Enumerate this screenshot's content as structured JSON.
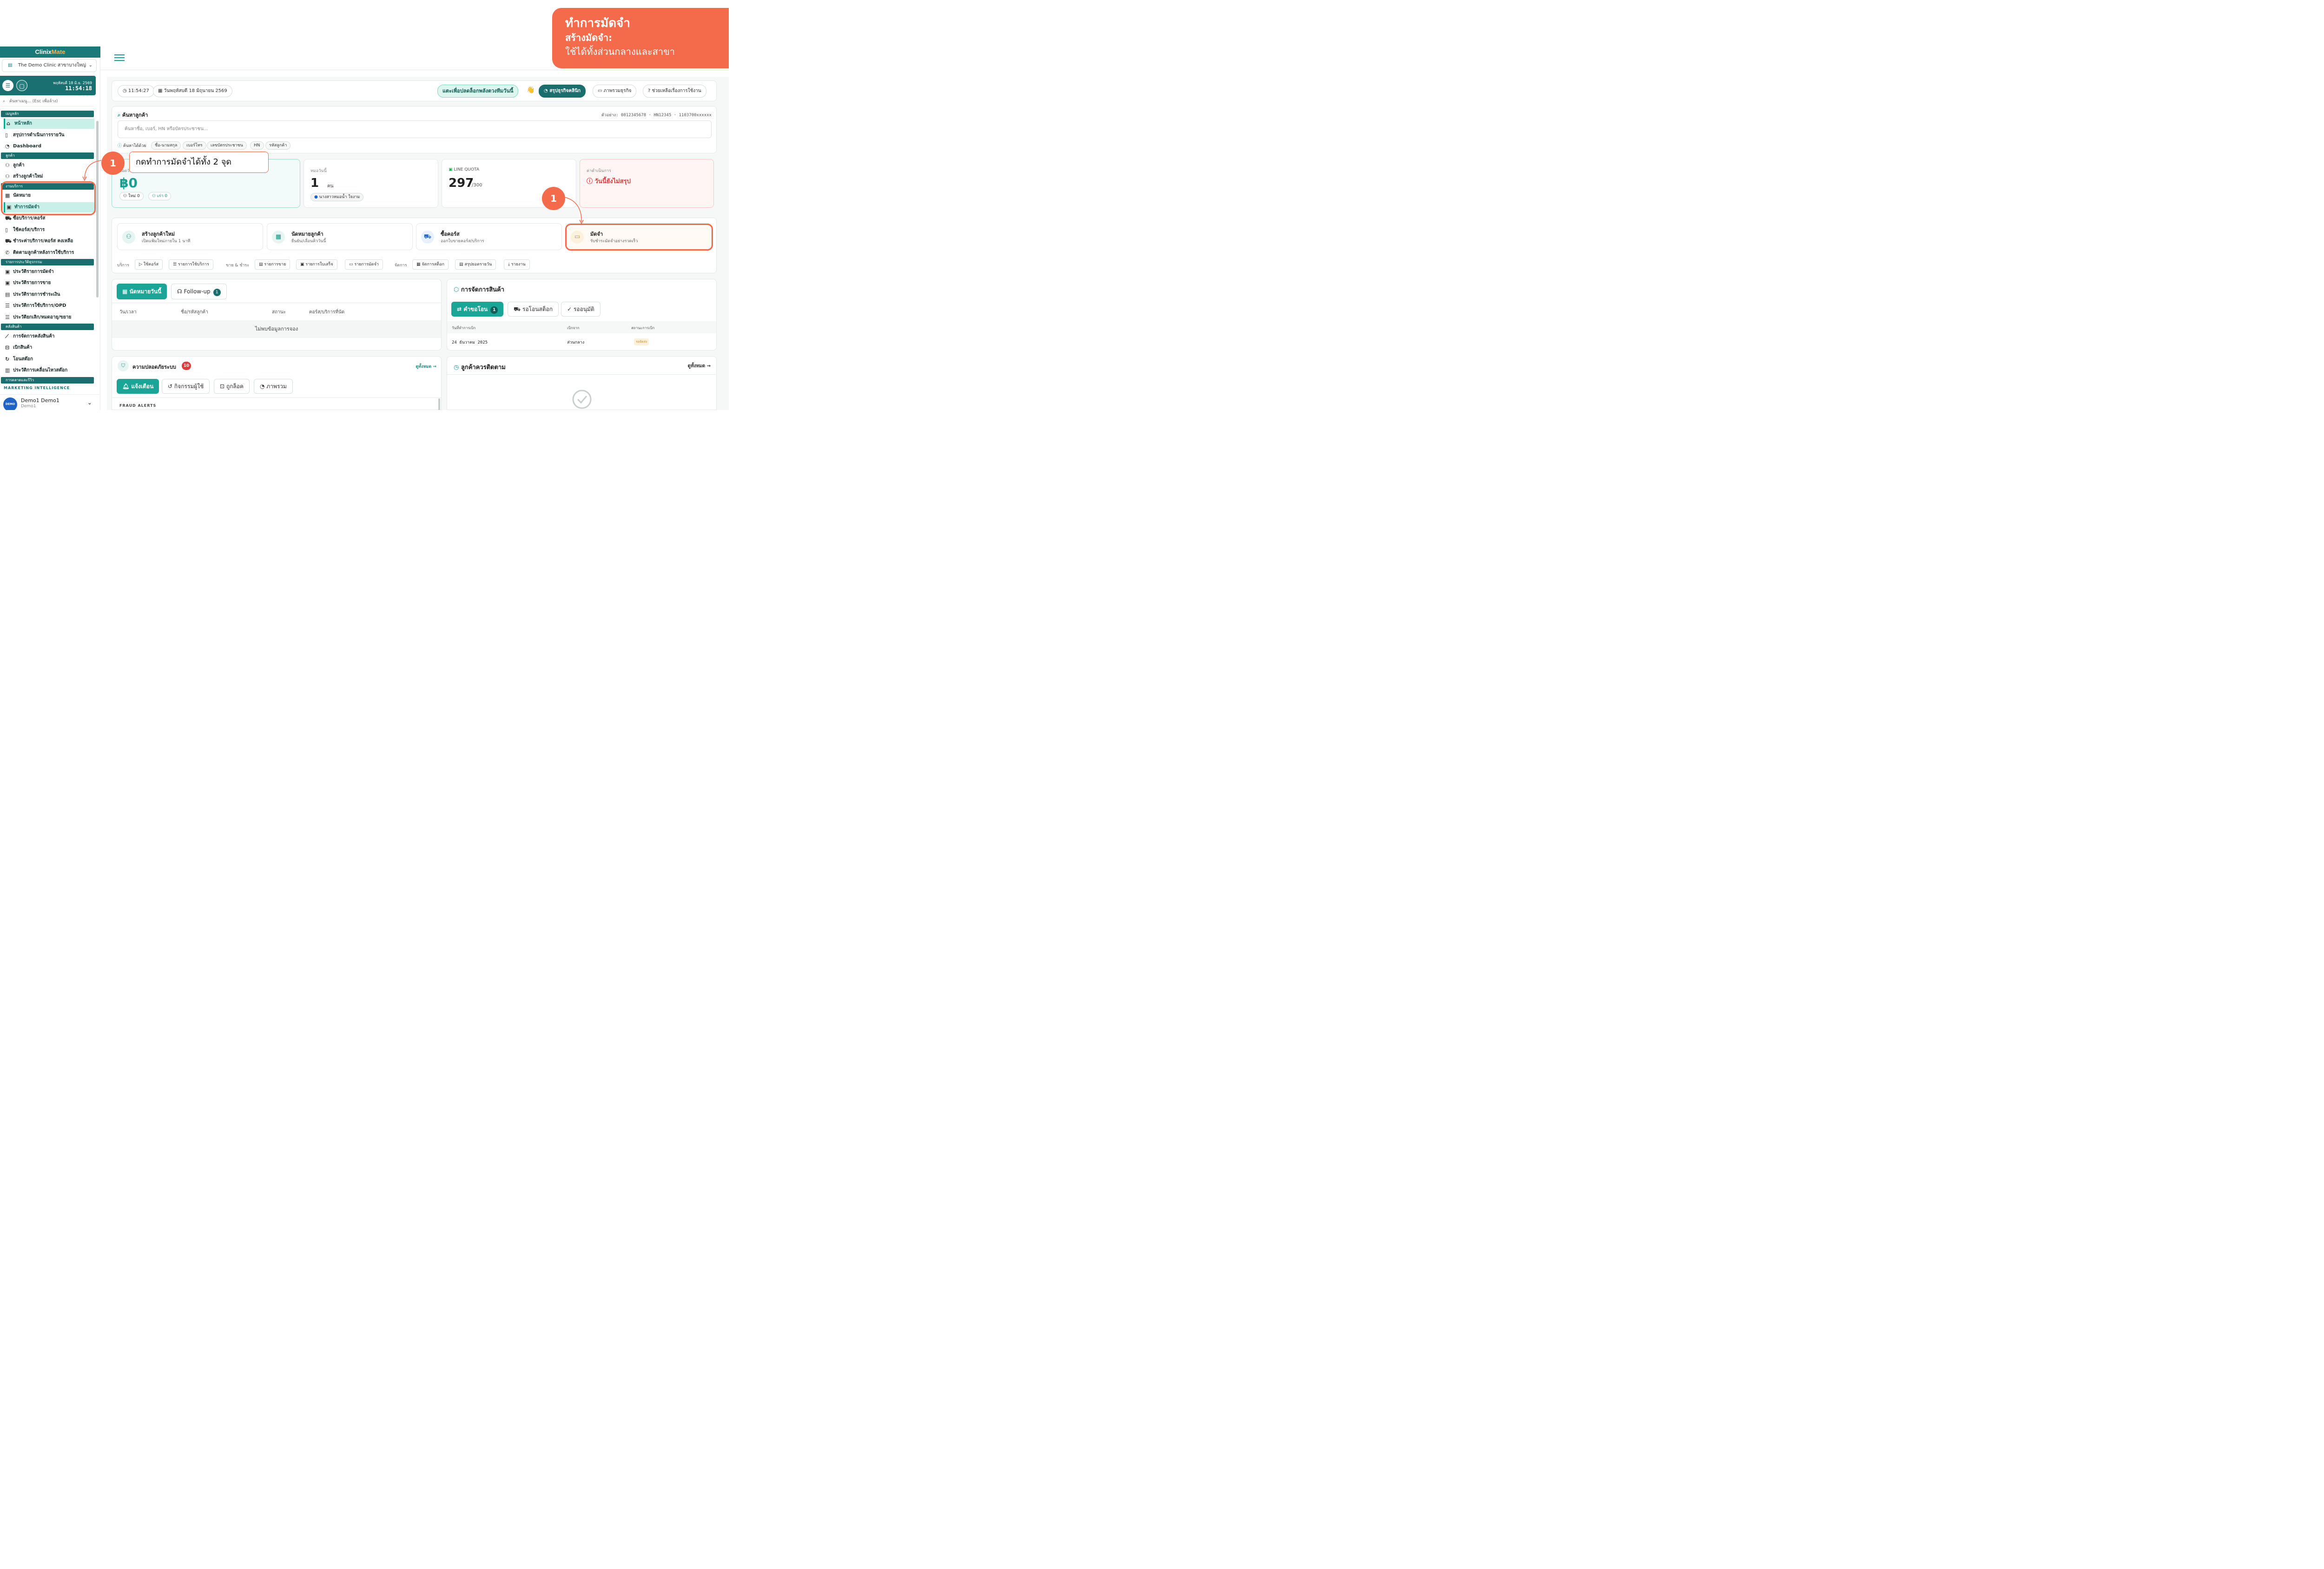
{
  "banner": {
    "title": "ทำการมัดจำ",
    "subtitle": "สร้างมัดจำ:",
    "desc": "ใช้ได้ทั้งส่วนกลางและสาขา"
  },
  "sidebar": {
    "brand_a": "Clinix",
    "brand_b": "Mate",
    "clinic": "The Demo Clinic สาขาบางใหญ่",
    "clock_date": "พฤหัสบดี 18 มิ.ย. 2569",
    "clock_time": "11:54:18",
    "search_placeholder": "ค้นหาเมนู... (Esc เพื่อล้าง)",
    "sections": {
      "main": "เมนูหลัก",
      "customer": "ลูกค้า",
      "service": "งานบริการ",
      "history": "รายการประวัติธุรกรรม",
      "stock": "คลังสินค้า",
      "marketing": "การตลาดและรีวิว"
    },
    "items": {
      "home": "หน้าหลัก",
      "daily": "สรุปการดำเนินการรายวัน",
      "dashboard": "Dashboard",
      "customers": "ลูกค้า",
      "new_customer": "สร้างลูกค้าใหม่",
      "appointments": "นัดหมาย",
      "deposit": "ทำการมัดจำ",
      "buy": "ซื้อบริการ/คอร์ส",
      "use": "ใช้คอร์ส/บริการ",
      "pay_remain": "ชำระค่าบริการ/คอร์ส คงเหลือ",
      "followup": "ติดตามลูกค้าหลังการใช้บริการ",
      "h_deposit": "ประวัติรายการมัดจำ",
      "h_sales": "ประวัติรายการขาย",
      "h_pay": "ประวัติรายการชำระเงิน",
      "h_opd": "ประวัติการใช้บริการ/OPD",
      "h_cancel": "ประวัติยกเลิก/หมดอายุ/ขยาย",
      "stock_manage": "การจัดการคลังสินค้า",
      "withdraw": "เบิกสินค้า",
      "transfer": "โอนสต๊อก",
      "movement": "ประวัติการเคลื่อนไหวสต๊อก"
    },
    "marketing_intel": "MARKETING INTELLIGENCE",
    "user_name": "Demo1 Demo1",
    "user_sub": "Demo1",
    "avatar": "DEMO"
  },
  "topbar": {
    "time": "11:54:27",
    "date": "วันพฤหัสบดี 18 มิถุนายน 2569",
    "unlock": "แตะเพื่อปลดล็อกพลังตวงทีมวันนี้",
    "summary": "สรุปธุรกิจคลินิก",
    "overview": "ภาพรวมธุรกิจ",
    "help": "ช่วยเหลือเรื่องการใช้งาน"
  },
  "search": {
    "title": "ค้นหาลูกค้า",
    "example": "ตัวอย่าง: 0812345678 · HN12345 · 1103700xxxxxx",
    "placeholder": "ค้นหาชื่อ, เบอร์, HN หรือบัตรประชาชน...",
    "by": "ค้นหาได้ด้วย",
    "tags": [
      "ชื่อ-นามสกุล",
      "เบอร์โทร",
      "เลขบัตรประชาชน",
      "HN",
      "รหัสลูกค้า"
    ]
  },
  "stats": {
    "sales_label": "ยอดวันนี้",
    "sales_value": "฿0",
    "new": "ใหม่ 0",
    "old": "เก่า 0",
    "doctor_label": "หมอวันนี้",
    "doctor_value": "1",
    "doctor_unit": "คน",
    "doctor_name": "นางสาวหมอน้ำ ใจงาม",
    "quota_label": "LINE QUOTA",
    "quota_value": "297",
    "quota_max": "/300",
    "ops_label": "ค่าดำเนินการ",
    "ops_value": "วันนี้ยังไม่สรุป"
  },
  "quick": [
    {
      "title": "สร้างลูกค้าใหม่",
      "sub": "เปิดแฟ้มใหม่ภายใน 1 นาที"
    },
    {
      "title": "นัดหมายลูกค้า",
      "sub": "ยืนยัน/เลื่อนคิววันนี้"
    },
    {
      "title": "ซื้อคอร์ส",
      "sub": "ออกใบขายคอร์ส/บริการ"
    },
    {
      "title": "มัดจำ",
      "sub": "รับชำระมัดจำอย่างรวดเร็ว"
    }
  ],
  "toolbar": {
    "g1": "บริการ",
    "use_course": "ใช้คอร์ส",
    "service_list": "รายการใช้บริการ",
    "g2": "ขาย & ชำระ",
    "sales_list": "รายการขาย",
    "receipts": "รายการใบเสร็จ",
    "deposits": "รายการมัดจำ",
    "g3": "จัดการ",
    "stock": "จัดการสต็อก",
    "day_summary": "สรุปยอดรายวัน",
    "report": "รายงาน"
  },
  "appointments": {
    "tab_today": "นัดหมายวันนี้",
    "tab_follow": "Follow-up",
    "follow_count": "1",
    "cols": [
      "วัน/เวลา",
      "ชื่อ/รหัสลูกค้า",
      "สถานะ",
      "คอร์ส/บริการที่นัด"
    ],
    "empty": "ไม่พบข้อมูลการจอง"
  },
  "inventory": {
    "title": "การจัดการสินค้า",
    "tab_req": "คำขอโอน",
    "req_count": "1",
    "tab_pending": "รอโอนสต็อก",
    "tab_approve": "รออนุมัติ",
    "cols": [
      "วันที่ทำการเบิก",
      "เบิกจาก",
      "สถานะการเบิก"
    ],
    "row": {
      "date": "24 ธันวาคม 2025",
      "from": "ส่วนกลาง",
      "status": "รอจัดส่ง"
    }
  },
  "security": {
    "title": "ความปลอดภัยระบบ",
    "count": "10",
    "see_all": "ดูทั้งหมด →",
    "tabs": [
      "แจ้งเตือน",
      "กิจกรรมผู้ใช้",
      "ถูกล็อค",
      "ภาพรวม"
    ],
    "fraud": "FRAUD ALERTS"
  },
  "follow": {
    "title": "ลูกค้าควรติดตาม",
    "see_all": "ดูทั้งหมด →"
  },
  "callout": {
    "num": "1",
    "text": "กดทำการมัดจำได้ทั้ง 2 จุด"
  }
}
